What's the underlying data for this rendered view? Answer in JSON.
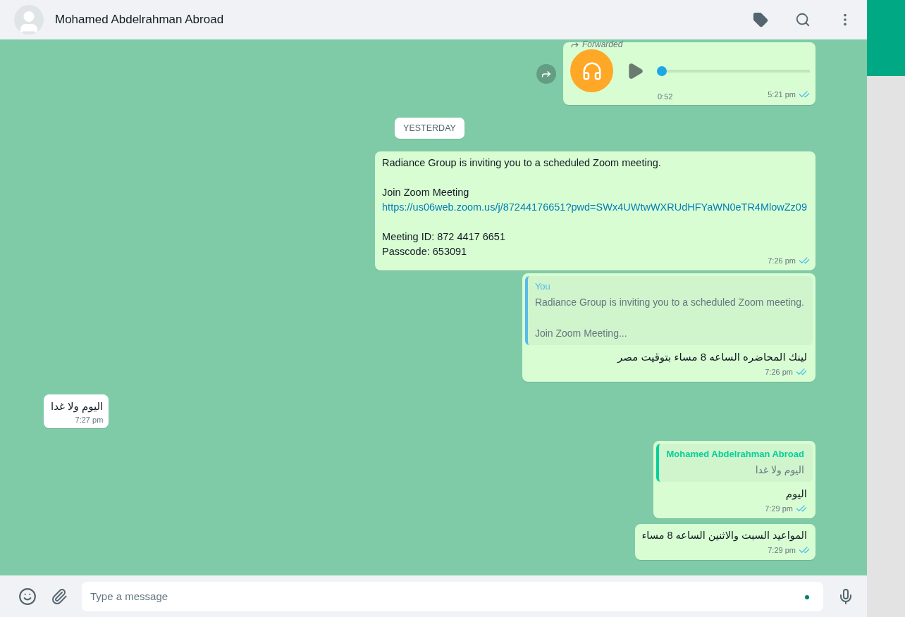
{
  "header": {
    "contact_name": "Mohamed Abdelrahman Abroad"
  },
  "messages": [
    {
      "kind": "audio",
      "forwarded_label": "Forwarded",
      "duration": "0:52",
      "time": "5:21 pm",
      "read": true,
      "level": 0
    },
    {
      "kind": "date",
      "label": "YESTERDAY"
    },
    {
      "kind": "text",
      "blocks": [
        [
          {
            "kind": "text",
            "text": "Radiance Group is inviting you to a scheduled Zoom meeting."
          }
        ],
        [
          {
            "kind": "text",
            "text": "Join Zoom Meeting"
          },
          {
            "kind": "link",
            "text": "https://us06web.zoom.us/j/87244176651?pwd=SWx4UWtwWXRUdHFYaWN0eTR4MlowZz09"
          }
        ],
        [
          {
            "kind": "text",
            "text": "Meeting ID: 872 4417 6651"
          },
          {
            "kind": "text",
            "text": "Passcode: 653091"
          }
        ]
      ],
      "time": "7:26 pm",
      "read": true
    },
    {
      "kind": "reply",
      "quote_author": "You",
      "color": "#53bdeb",
      "quote_lines": [
        "Radiance Group is inviting you to a scheduled Zoom meeting.",
        "Join Zoom Meeting..."
      ],
      "text": "لينك المحاضره الساعه 8 مساء بتوقيت مصر",
      "time": "7:26 pm",
      "read": true
    },
    {
      "kind": "incoming",
      "text": "اليوم ولا غدا",
      "time": "7:27 pm"
    },
    {
      "kind": "reply",
      "quote_author": "Mohamed Abdelrahman Abroad",
      "color": "#06cf9c",
      "quote_lines": [
        "اليوم ولا غدا"
      ],
      "text": "اليوم",
      "time": "7:29 pm",
      "read": true
    },
    {
      "kind": "text",
      "blocks": [
        [
          {
            "kind": "text",
            "text": "المواعيد السبت والاثنين الساعه 8 مساء"
          }
        ]
      ],
      "time": "7:29 pm",
      "read": true
    }
  ],
  "composer": {
    "placeholder": "Type a message"
  }
}
